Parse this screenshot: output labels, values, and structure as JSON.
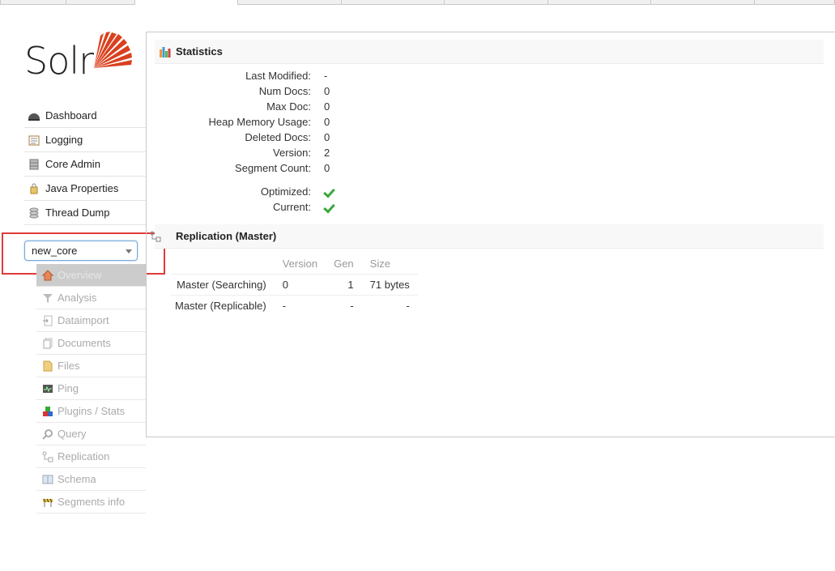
{
  "logo": {
    "text": "Solr"
  },
  "nav": {
    "items": [
      {
        "label": "Dashboard",
        "icon": "dashboard-icon"
      },
      {
        "label": "Logging",
        "icon": "logging-icon"
      },
      {
        "label": "Core Admin",
        "icon": "core-admin-icon"
      },
      {
        "label": "Java Properties",
        "icon": "java-properties-icon"
      },
      {
        "label": "Thread Dump",
        "icon": "thread-dump-icon"
      }
    ]
  },
  "core_selector": {
    "value": "new_core"
  },
  "core_nav": {
    "items": [
      {
        "label": "Overview",
        "icon": "home-icon"
      },
      {
        "label": "Analysis",
        "icon": "funnel-icon"
      },
      {
        "label": "Dataimport",
        "icon": "dataimport-icon"
      },
      {
        "label": "Documents",
        "icon": "documents-icon"
      },
      {
        "label": "Files",
        "icon": "files-icon"
      },
      {
        "label": "Ping",
        "icon": "ping-icon"
      },
      {
        "label": "Plugins / Stats",
        "icon": "plugins-icon"
      },
      {
        "label": "Query",
        "icon": "query-icon"
      },
      {
        "label": "Replication",
        "icon": "replication-icon"
      },
      {
        "label": "Schema",
        "icon": "schema-icon"
      },
      {
        "label": "Segments info",
        "icon": "segments-icon"
      }
    ]
  },
  "statistics": {
    "title": "Statistics",
    "rows": [
      {
        "label": "Last Modified:",
        "value": "-"
      },
      {
        "label": "Num Docs:",
        "value": "0"
      },
      {
        "label": "Max Doc:",
        "value": "0"
      },
      {
        "label": "Heap Memory Usage:",
        "value": "0"
      },
      {
        "label": "Deleted Docs:",
        "value": "0"
      },
      {
        "label": "Version:",
        "value": "2"
      },
      {
        "label": "Segment Count:",
        "value": "0"
      }
    ],
    "flags": [
      {
        "label": "Optimized:",
        "status": "check"
      },
      {
        "label": "Current:",
        "status": "check"
      }
    ]
  },
  "replication": {
    "title": "Replication (Master)",
    "columns": [
      "Version",
      "Gen",
      "Size"
    ],
    "rows": [
      {
        "name": "Master (Searching)",
        "version": "0",
        "gen": "1",
        "size": "71 bytes"
      },
      {
        "name": "Master (Replicable)",
        "version": "-",
        "gen": "-",
        "size": "-"
      }
    ]
  },
  "colors": {
    "accent": "#d9411e",
    "highlight_border": "#e03a3a",
    "check": "#3aa83a"
  }
}
